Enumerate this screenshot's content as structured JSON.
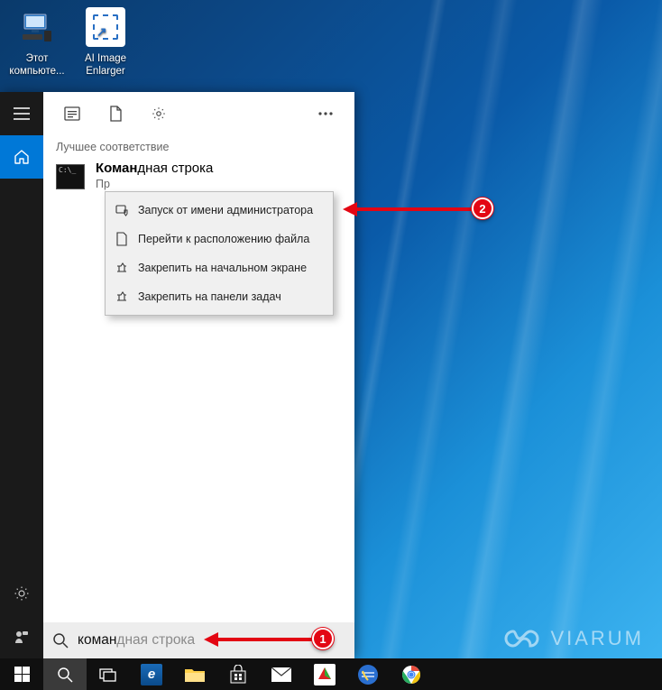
{
  "desktop_icons": [
    {
      "id": "this-pc",
      "label": "Этот компьюте..."
    },
    {
      "id": "ai-enlarger",
      "label": "AI Image Enlarger"
    }
  ],
  "search": {
    "best_match_header": "Лучшее соответствие",
    "result": {
      "title_match": "Коман",
      "title_rest": "дная строка",
      "subtitle_visible": "Пр"
    },
    "context_menu": {
      "run_as_admin": "Запуск от имени администратора",
      "open_location": "Перейти к расположению файла",
      "pin_start": "Закрепить на начальном экране",
      "pin_taskbar": "Закрепить на панели задач"
    },
    "input": {
      "typed": "коман",
      "completion": "дная строка"
    }
  },
  "annotations": {
    "badge1": "1",
    "badge2": "2"
  },
  "watermark": "VIARUM",
  "taskbar": {
    "items": [
      "start",
      "search",
      "taskview",
      "edge",
      "explorer",
      "store",
      "mail",
      "app1",
      "app2",
      "chrome"
    ]
  }
}
